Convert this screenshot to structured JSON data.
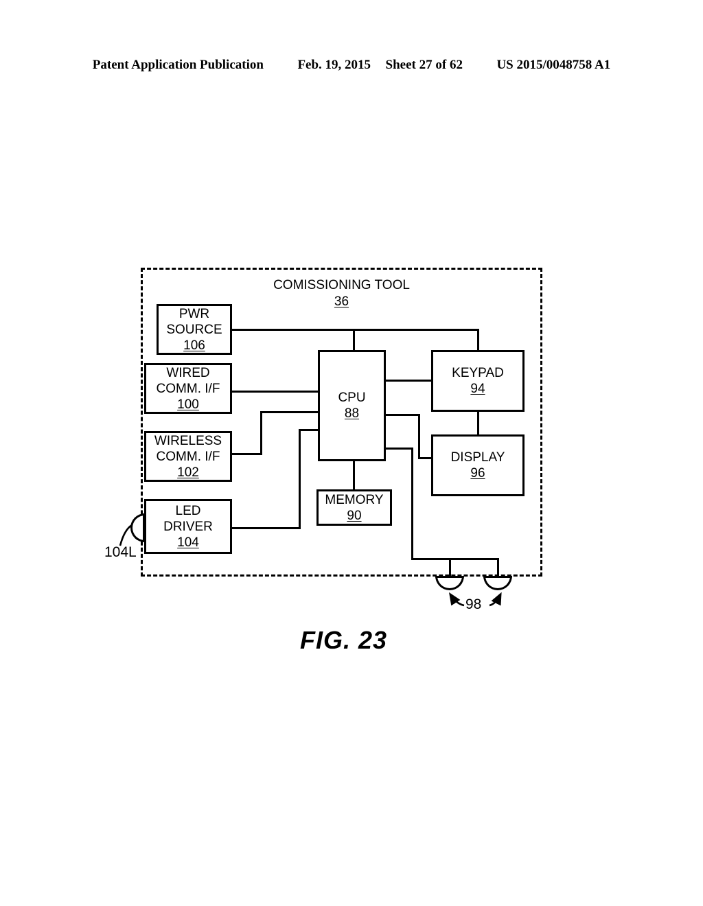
{
  "header": {
    "publication": "Patent Application Publication",
    "date": "Feb. 19, 2015",
    "sheet": "Sheet 27 of 62",
    "number": "US 2015/0048758 A1"
  },
  "figure": {
    "caption": "FIG. 23",
    "enclosure": {
      "title": "COMISSIONING TOOL",
      "ref": "36"
    },
    "blocks": [
      {
        "id": "pwr-source",
        "lines": [
          "PWR",
          "SOURCE"
        ],
        "ref": "106"
      },
      {
        "id": "wired-comm-if",
        "lines": [
          "WIRED",
          "COMM. I/F"
        ],
        "ref": "100"
      },
      {
        "id": "wireless-comm-if",
        "lines": [
          "WIRELESS",
          "COMM. I/F"
        ],
        "ref": "102"
      },
      {
        "id": "led-driver",
        "lines": [
          "LED",
          "DRIVER"
        ],
        "ref": "104"
      },
      {
        "id": "cpu",
        "lines": [
          "CPU"
        ],
        "ref": "88"
      },
      {
        "id": "memory",
        "lines": [
          "MEMORY"
        ],
        "ref": "90"
      },
      {
        "id": "keypad",
        "lines": [
          "KEYPAD"
        ],
        "ref": "94"
      },
      {
        "id": "display",
        "lines": [
          "DISPLAY"
        ],
        "ref": "96"
      }
    ],
    "callouts": [
      {
        "id": "led-port",
        "label": "104L"
      },
      {
        "id": "comm-ports",
        "label": "98"
      }
    ]
  }
}
